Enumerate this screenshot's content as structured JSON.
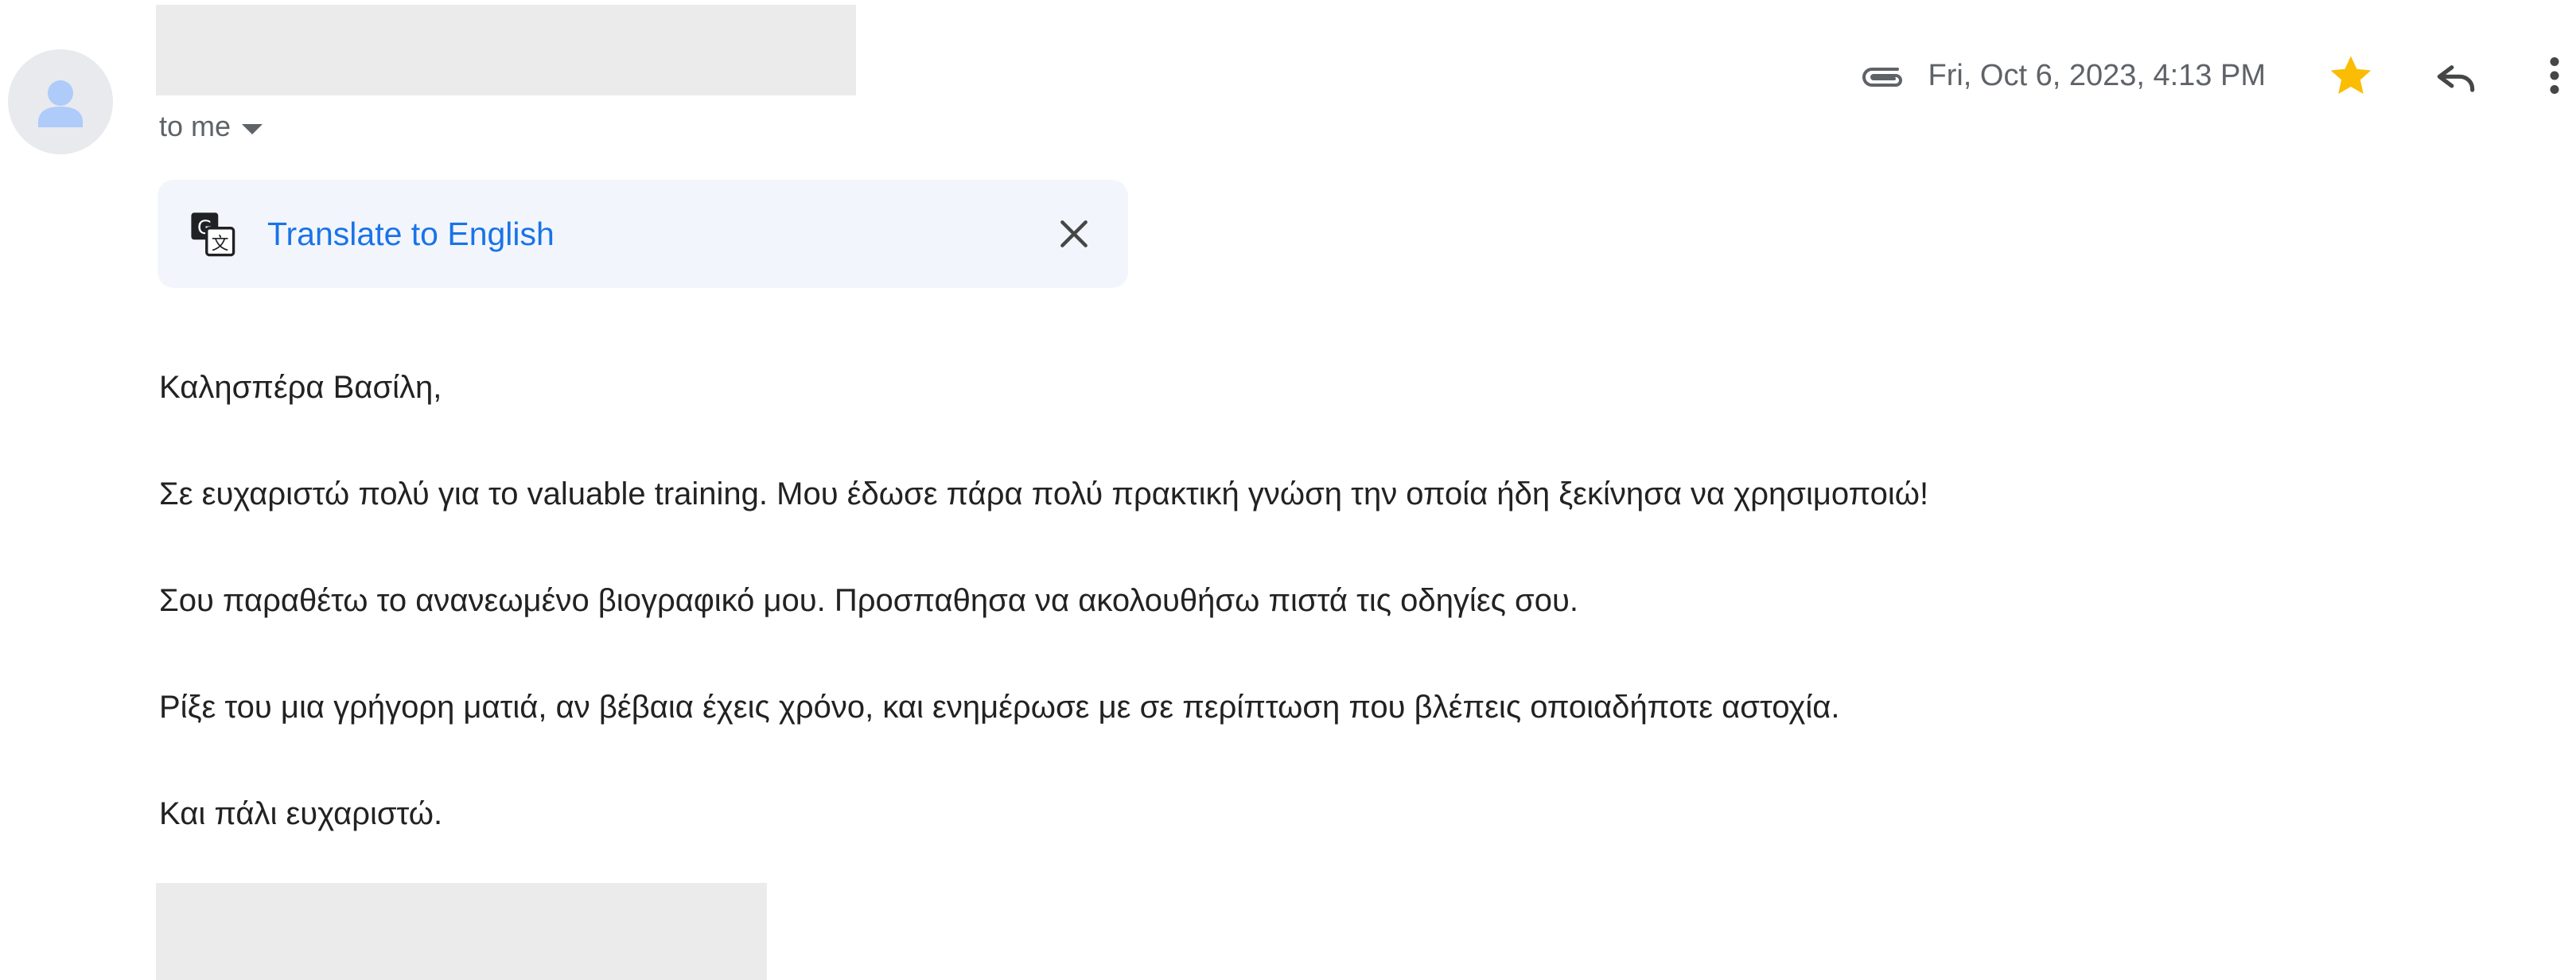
{
  "header": {
    "recipient_label": "to me",
    "date": "Fri, Oct 6, 2023, 4:13 PM",
    "icons": [
      "avatar-person-icon",
      "attachment-icon",
      "star-icon",
      "reply-icon",
      "more-vert-icon",
      "caret-down-icon"
    ],
    "star_color": "#fbbc04"
  },
  "translate": {
    "link_label": "Translate to English",
    "icons": [
      "translate-icon",
      "close-icon"
    ],
    "link_color": "#1a73e8"
  },
  "message": {
    "greeting": "Καλησπέρα Βασίλη,",
    "paragraph_1": "Σε ευχαριστώ πολύ για το valuable training. Μου έδωσε πάρα πολύ πρακτική γνώση την οποία ήδη ξεκίνησα να χρησιμοποιώ!",
    "paragraph_2": "Σου παραθέτω το ανανεωμένο βιογραφικό μου. Προσπαθησα να ακολουθήσω πιστά τις οδηγίες σου.",
    "paragraph_3": "Ρίξε του μια γρήγορη ματιά, αν βέβαια έχεις χρόνο, και ενημέρωσε με σε περίπτωση που βλέπεις οποιαδήποτε αστοχία.",
    "closing": "Και πάλι ευχαριστώ."
  }
}
